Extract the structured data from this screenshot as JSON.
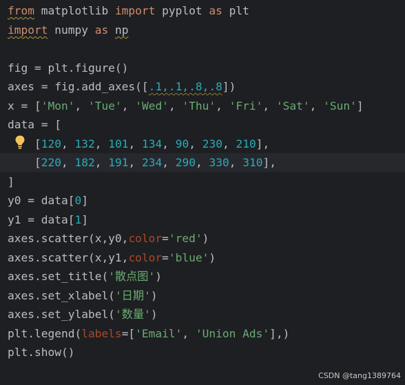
{
  "editor": {
    "line1": {
      "kw1": "from",
      "mod": " matplotlib ",
      "kw2": "import",
      "name": " pyplot ",
      "kw3": "as",
      "alias": " plt"
    },
    "line2": {
      "kw1": "import",
      "mod": " numpy ",
      "kw2": "as",
      "alias": "np"
    },
    "line4": {
      "text": "fig = plt.figure()"
    },
    "line5": {
      "pre": "axes = fig.add_axes([",
      "args": ".1,.1,.8,.8",
      "post": "])"
    },
    "line6": {
      "pre": "x = [",
      "items": [
        "'Mon'",
        "'Tue'",
        "'Wed'",
        "'Thu'",
        "'Fri'",
        "'Sat'",
        "'Sun'"
      ],
      "post": "]"
    },
    "line7": {
      "text": "data = ["
    },
    "line8": {
      "indent": "    [",
      "nums": [
        "120",
        "132",
        "101",
        "134",
        "90",
        "230",
        "210"
      ],
      "post": "],"
    },
    "line9": {
      "indent": "    [",
      "nums": [
        "220",
        "182",
        "191",
        "234",
        "290",
        "330",
        "310"
      ],
      "post": "],"
    },
    "line10": {
      "text": "]"
    },
    "line11": {
      "pre": "y0 = data[",
      "idx": "0",
      "post": "]"
    },
    "line12": {
      "pre": "y1 = data[",
      "idx": "1",
      "post": "]"
    },
    "line13": {
      "pre": "axes.scatter(x,y0,",
      "param": "color",
      "eq": "=",
      "str": "'red'",
      "post": ")"
    },
    "line14": {
      "pre": "axes.scatter(x,y1,",
      "param": "color",
      "eq": "=",
      "str": "'blue'",
      "post": ")"
    },
    "line15": {
      "pre": "axes.set_title(",
      "str": "'散点图'",
      "post": ")"
    },
    "line16": {
      "pre": "axes.set_xlabel(",
      "str": "'日期'",
      "post": ")"
    },
    "line17": {
      "pre": "axes.set_ylabel(",
      "str": "'数量'",
      "post": ")"
    },
    "line18": {
      "pre": "plt.legend(",
      "param": "labels",
      "eq": "=[",
      "str1": "'Email'",
      "sep": ", ",
      "str2": "'Union Ads'",
      "post": "],)"
    },
    "line19": {
      "text": "plt.show()"
    }
  },
  "watermark": "CSDN @tang1389764",
  "colors": {
    "background": "#1e1f22",
    "keyword": "#cf8e6d",
    "string": "#6aab73",
    "number": "#2aacb8",
    "param": "#aa4926",
    "text": "#bcbec4",
    "bulb": "#f2c55c"
  },
  "icons": {
    "gutter": "lightbulb-icon"
  }
}
